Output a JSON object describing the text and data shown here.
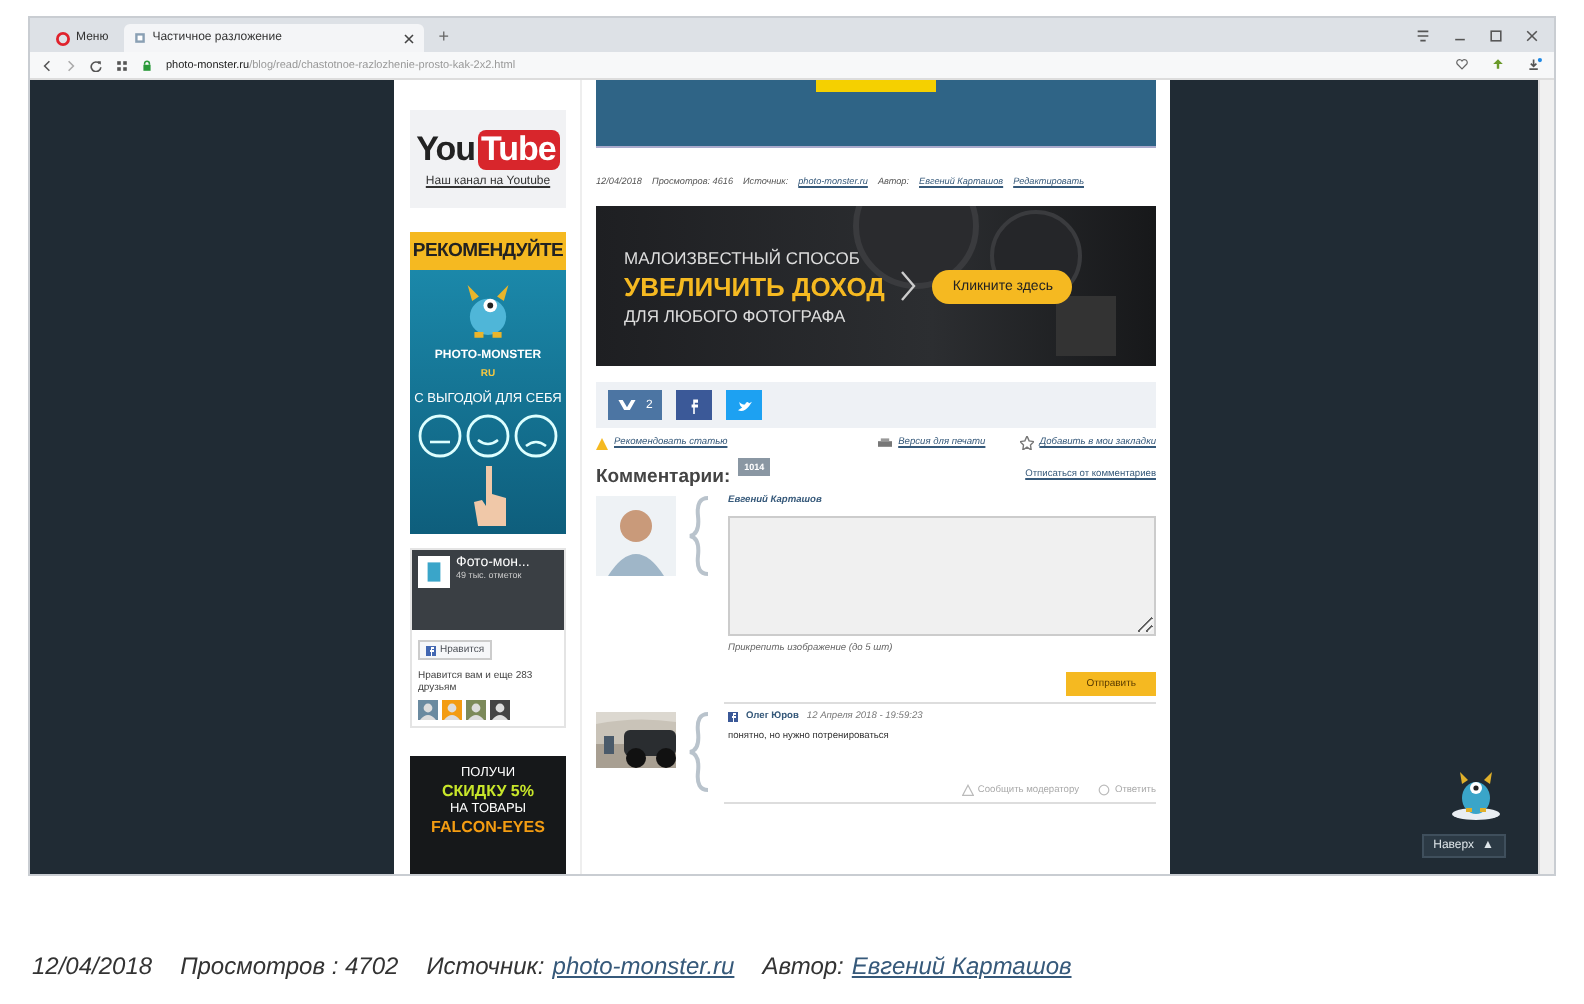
{
  "browser": {
    "tabs": [
      {
        "label": "Меню",
        "kind": "menu",
        "selected": false
      },
      {
        "label": "Частичное разложение",
        "kind": "page",
        "selected": true
      }
    ],
    "new_tab": "+",
    "address": {
      "host": "photo-monster.ru",
      "path": "/blog/read/chastotnoe-razlozhenie-prosto-kak-2x2.html"
    }
  },
  "sidebar": {
    "youtube": {
      "logo_left": "You",
      "logo_right": "Tube",
      "link": "Наш канал на Youtube"
    },
    "promo": {
      "header": "РЕКОМЕНДУЙТЕ",
      "brand": "PHOTO-MONSTER",
      "brand_suffix": "RU",
      "tagline": "С ВЫГОДОЙ ДЛЯ СЕБЯ"
    },
    "facebook": {
      "page": "Фото-мон...",
      "likes": "49 тыс. отметок",
      "like_button": "Нравится",
      "friends": "Нравится вам и еще 283 друзьям"
    },
    "ad": {
      "lines": [
        "ПОЛУЧИ",
        "СКИДКУ 5%",
        "НА ТОВАРЫ",
        "FALCON-EYES"
      ]
    }
  },
  "article": {
    "meta": {
      "date": "12/04/2018",
      "views": "Просмотров: 4616",
      "source_label": "Источник:",
      "source": "photo-monster.ru",
      "author_label": "Автор:",
      "author": "Евгений Карташов",
      "edit": "Редактировать"
    },
    "banner": {
      "line1": "МАЛОИЗВЕСТНЫЙ СПОСОБ",
      "line2": "УВЕЛИЧИТЬ ДОХОД",
      "line3": "ДЛЯ ЛЮБОГО ФОТОГРАФА",
      "button": "Кликните здесь"
    },
    "share": [
      {
        "kind": "vk",
        "count": "2"
      },
      {
        "kind": "facebook"
      },
      {
        "kind": "twitter"
      }
    ],
    "actions": [
      {
        "kind": "recommend",
        "label": "Рекомендовать статью"
      },
      {
        "kind": "print",
        "label": "Версия для печати"
      },
      {
        "kind": "bookmark",
        "label": "Добавить в мои закладки"
      }
    ],
    "comments": {
      "title": "Комментарии:",
      "count": "1014",
      "unsubscribe": "Отписаться от комментариев",
      "form": {
        "author": "Евгений Карташов",
        "attach": "Прикрепить изображение (до 5 шт)",
        "submit": "Отправить"
      },
      "items": [
        {
          "author": "Олег Юров",
          "date": "12 Апреля 2018 - 19:59:23",
          "text": "понятно, но нужно потренироваться",
          "report": "Сообщить модератору",
          "reply": "Ответить"
        }
      ]
    }
  },
  "up_button": {
    "label": "Наверх",
    "arrow": "▲"
  },
  "caption": {
    "date": "12/04/2018",
    "views": "Просмотров : 4702",
    "source_label": "Источник:",
    "source": "photo-monster.ru",
    "author_label": "Автор:",
    "author": "Евгений Карташов"
  }
}
